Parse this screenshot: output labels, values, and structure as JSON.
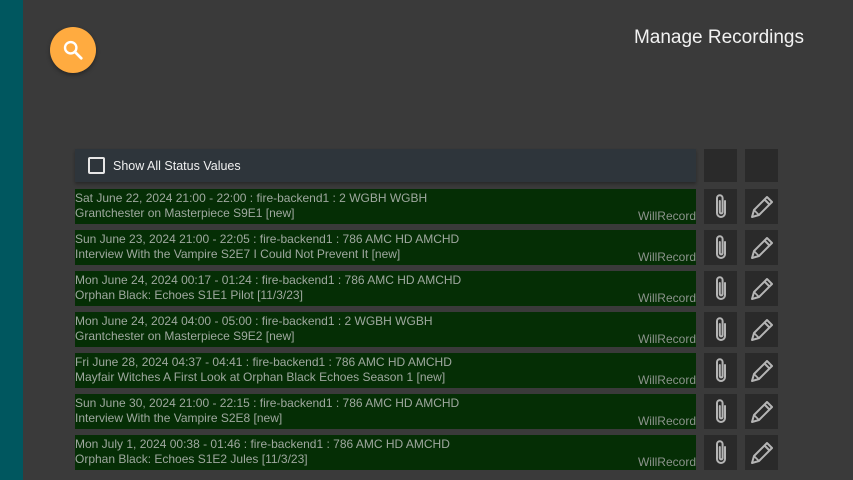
{
  "header": {
    "title": "Manage Recordings"
  },
  "filter": {
    "show_all_label": "Show All Status Values",
    "checked": false
  },
  "icons": {
    "search": "search-icon",
    "attach": "paperclip-icon",
    "edit": "pencil-icon"
  },
  "colors": {
    "accent": "#ffab40",
    "side_strip": "#00575f",
    "recording_bg": "#052e05"
  },
  "recordings": [
    {
      "line1": "Sat June 22, 2024 21:00 - 22:00 : fire-backend1 : 2 WGBH WGBH",
      "line2": "Grantchester on Masterpiece  S9E1  [new]",
      "status": "WillRecord"
    },
    {
      "line1": "Sun June 23, 2024 21:00 - 22:05 : fire-backend1 : 786 AMC HD AMCHD",
      "line2": "Interview With the Vampire  S2E7 I Could Not Prevent It [new]",
      "status": "WillRecord"
    },
    {
      "line1": "Mon June 24, 2024 00:17 - 01:24 : fire-backend1 : 786 AMC HD AMCHD",
      "line2": "Orphan Black: Echoes  S1E1 Pilot [11/3/23]",
      "status": "WillRecord"
    },
    {
      "line1": "Mon June 24, 2024 04:00 - 05:00 : fire-backend1 : 2 WGBH WGBH",
      "line2": "Grantchester on Masterpiece  S9E2  [new]",
      "status": "WillRecord"
    },
    {
      "line1": "Fri June 28, 2024 04:37 - 04:41 : fire-backend1 : 786 AMC HD AMCHD",
      "line2": "Mayfair Witches  A First Look at Orphan Black Echoes Season 1 [new]",
      "status": "WillRecord"
    },
    {
      "line1": "Sun June 30, 2024 21:00 - 22:15 : fire-backend1 : 786 AMC HD AMCHD",
      "line2": "Interview With the Vampire  S2E8  [new]",
      "status": "WillRecord"
    },
    {
      "line1": "Mon July 1, 2024 00:38 - 01:46 : fire-backend1 : 786 AMC HD AMCHD",
      "line2": "Orphan Black: Echoes  S1E2 Jules [11/3/23]",
      "status": "WillRecord"
    }
  ]
}
